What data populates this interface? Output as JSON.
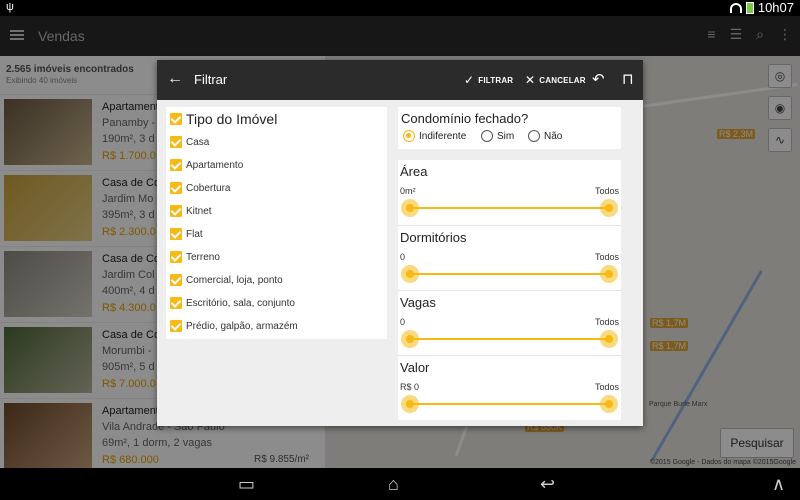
{
  "status_bar": {
    "time": "10h07"
  },
  "app_bar": {
    "title": "Vendas"
  },
  "list": {
    "count": "2.565 imóveis encontrados",
    "showing": "Exibindo 40 imóveis",
    "items": [
      {
        "title": "Apartament",
        "location": "Panamby -",
        "details": "190m², 3 d",
        "price": "R$ 1.700.0",
        "price_m2": ""
      },
      {
        "title": "Casa de Co",
        "location": "Jardim Mo",
        "details": "395m², 3 d",
        "price": "R$ 2.300.0",
        "price_m2": ""
      },
      {
        "title": "Casa de Co",
        "location": "Jardim Col",
        "details": "400m², 4 d",
        "price": "R$ 4.300.0",
        "price_m2": ""
      },
      {
        "title": "Casa de Co",
        "location": "Morumbi -",
        "details": "905m², 5 d",
        "price": "R$ 7.000.0",
        "price_m2": ""
      },
      {
        "title": "Apartament",
        "location": "Vila Andrade - São Paulo",
        "details": "69m², 1 dorm, 2 vagas",
        "price": "R$ 680.000",
        "price_m2": "R$ 9.855/m²"
      }
    ]
  },
  "map": {
    "tags": [
      "R$ 2,3M",
      "R$ 1,7M",
      "R$ 1,7M",
      "R$ 680K"
    ],
    "park": "Parque Burle Marx",
    "search_button": "Pesquisar",
    "copyright": "©2015 Google - Dados do mapa ©2015Google"
  },
  "dialog": {
    "title": "Filtrar",
    "filter_label": "FILTRAR",
    "cancel_label": "CANCELAR",
    "tipo": {
      "heading": "Tipo do Imóvel",
      "options": [
        "Casa",
        "Apartamento",
        "Cobertura",
        "Kitnet",
        "Flat",
        "Terreno",
        "Comercial, loja, ponto",
        "Escritório, sala, conjunto",
        "Prédio, galpão, armazém"
      ]
    },
    "condominio": {
      "heading": "Condomínio fechado?",
      "options": [
        "Indiferente",
        "Sim",
        "Não"
      ],
      "selected": "Indiferente"
    },
    "ranges": [
      {
        "label": "Área",
        "min": "0m²",
        "max": "Todos"
      },
      {
        "label": "Dormitórios",
        "min": "0",
        "max": "Todos"
      },
      {
        "label": "Vagas",
        "min": "0",
        "max": "Todos"
      },
      {
        "label": "Valor",
        "min": "R$ 0",
        "max": "Todos"
      }
    ]
  },
  "colors": {
    "accent": "#f6b915",
    "appbar": "#2b2b2b"
  }
}
